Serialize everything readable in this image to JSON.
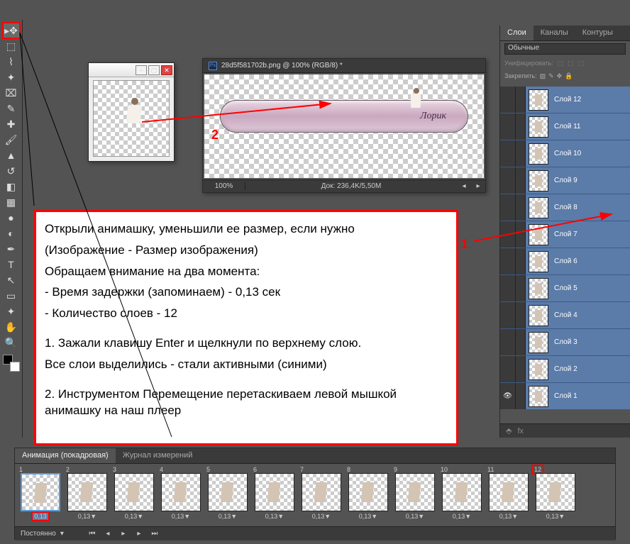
{
  "doc": {
    "tab_title": "28d5f581702b.png @ 100% (RGB/8) *",
    "zoom": "100%",
    "info": "Док: 236,4K/5,50M",
    "signature": "Лорик"
  },
  "annotations": {
    "num1": "1",
    "num2": "2"
  },
  "instructions": {
    "l1": "Открыли анимашку, уменьшили ее размер, если нужно",
    "l2": "(Изображение - Размер изображения)",
    "l3": "Обращаем внимание на два момента:",
    "l4": "- Время задержки (запоминаем) -  0,13 сек",
    "l5": "- Количество слоев - 12",
    "l6": "1.  Зажали клавишу Enter и щелкнули по верхнему слою.",
    "l7": "Все слои выделились - стали активными (синими)",
    "l8": "2. Инструментом  Перемещение  перетаскиваем левой мышкой анимашку на наш плеер"
  },
  "layers_panel": {
    "tabs": {
      "layers": "Слои",
      "channels": "Каналы",
      "paths": "Контуры"
    },
    "blend_mode": "Обычные",
    "unify": "Унифицировать:",
    "lock": "Закрепить:",
    "items": [
      {
        "name": "Слой 12"
      },
      {
        "name": "Слой 11"
      },
      {
        "name": "Слой 10"
      },
      {
        "name": "Слой 9"
      },
      {
        "name": "Слой 8"
      },
      {
        "name": "Слой 7"
      },
      {
        "name": "Слой 6"
      },
      {
        "name": "Слой 5"
      },
      {
        "name": "Слой 4"
      },
      {
        "name": "Слой 3"
      },
      {
        "name": "Слой 2"
      },
      {
        "name": "Слой 1"
      }
    ]
  },
  "animation": {
    "tabs": {
      "frames": "Анимация (покадровая)",
      "log": "Журнал измерений"
    },
    "frames": [
      {
        "n": "1",
        "d": "0,13"
      },
      {
        "n": "2",
        "d": "0,13▼"
      },
      {
        "n": "3",
        "d": "0,13▼"
      },
      {
        "n": "4",
        "d": "0,13▼"
      },
      {
        "n": "5",
        "d": "0,13▼"
      },
      {
        "n": "6",
        "d": "0,13▼"
      },
      {
        "n": "7",
        "d": "0,13▼"
      },
      {
        "n": "8",
        "d": "0,13▼"
      },
      {
        "n": "9",
        "d": "0,13▼"
      },
      {
        "n": "10",
        "d": "0,13▼"
      },
      {
        "n": "11",
        "d": "0,13▼"
      },
      {
        "n": "12",
        "d": "0,13▼"
      }
    ],
    "loop": "Постоянно"
  },
  "win_buttons": {
    "min": "–",
    "max": "▢",
    "close": "✕"
  }
}
